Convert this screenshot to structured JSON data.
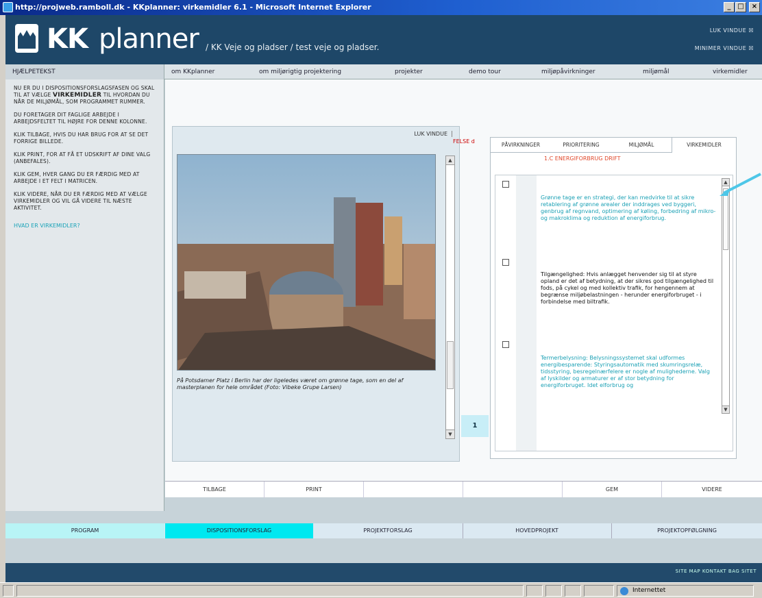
{
  "window": {
    "title": "http://projweb.ramboll.dk - KKplanner: virkemidler 6.1 - Microsoft Internet Explorer",
    "controls": [
      "_",
      "□",
      "×"
    ]
  },
  "header": {
    "brand_kk": "KK",
    "brand_planner": "planner",
    "breadcrumb": "/ KK Veje og pladser / test veje og pladser.",
    "close_window": "LUK VINDUE ☒",
    "minimize_window": "MINIMER VINDUE ☒"
  },
  "nav": {
    "help_heading": "HJÆLPETEKST",
    "items": [
      "om KKplanner",
      "om miljørigtig projektering",
      "projekter",
      "demo tour",
      "miljøpåvirkninger",
      "miljømål",
      "virkemidler"
    ]
  },
  "help": {
    "p1_a": "NU ER DU I DISPOSITIONSFORSLAGSFASEN OG SKAL TIL AT VÆLGE",
    "p1_b": "VIRKEMIDLER",
    "p1_c": "TIL HVORDAN DU NÅR DE MILJØMÅL, SOM PROGRAMMET RUMMER.",
    "p2": "DU FORETAGER DIT FAGLIGE ARBEJDE I ARBEJDSFELTET TIL HØJRE FOR DENNE KOLONNE.",
    "p3": "KLIK TILBAGE, HVIS DU HAR BRUG FOR AT SE DET FORRIGE BILLEDE.",
    "p4": "KLIK PRINT, FOR AT FÅ ET UDSKRIFT AF DINE VALG (ANBEFALES).",
    "p5": "KLIK GEM, HVER GANG DU ER FÆRDIG MED AT ARBEJDE I ET FELT I MATRICEN.",
    "p6": "KLIK VIDERE, NÅR DU ER FÆRDIG MED AT VÆLGE VIRKEMIDLER OG VIL GÅ VIDERE TIL NÆSTE AKTIVITET.",
    "link": "HVAD ER VIRKEMIDLER?"
  },
  "photo_panel": {
    "close_label": "LUK VINDUE",
    "caption": "På Potsdamer Platz i Berlin har der ligeledes været om grønne tage, som en del af masterplanen for hele området (Foto: Vibeke Grupe Larsen)",
    "tab_peek": "FELSE d",
    "row_number": "1"
  },
  "right_panel": {
    "tabs": [
      "PÅVIRKNINGER",
      "PRIORITERING",
      "MILJØMÅL",
      "VIRKEMIDLER"
    ],
    "subheading": "1.C ENERGIFORBRUG DRIFT",
    "items": [
      {
        "text": "Grønne tage er en strategi, der kan medvirke til at sikre retablering af grønne arealer der inddrages ved byggeri, genbrug af regnvand, optimering af køling, forbedring af mikro- og makroklima og reduktion af energiforbrug.",
        "style": "teal"
      },
      {
        "text": "Tilgængelighed: Hvis anlægget henvender sig til at styre opland er det af betydning, at der sikres god tilgængelighed til fods, på cykel og med kollektiv trafik, for hengennem at begrænse miljøbelastningen - herunder energiforbruget - i forbindelse med biltrafik.",
        "style": "dark"
      },
      {
        "text": "Termerbelysning: Belysningssystemet skal udformes energibesparende: Styringsautomatik med skumringsrelæ, tidsstyring, besregelnærfelere er nogle af mulighederne. Valg af lyskilder og armaturer er af stor betydning for energiforbruget. Idet elforbrug og",
        "style": "teal"
      }
    ]
  },
  "buttons": {
    "back": "TILBAGE",
    "print": "PRINT",
    "save": "GEM",
    "next": "VIDERE"
  },
  "steps": [
    "PROGRAM",
    "DISPOSITIONSFORSLAG",
    "PROJEKTFORSLAG",
    "HOVEDPROJEKT",
    "PROJEKTOPFØLGNING"
  ],
  "footer": "SITE MAP   KONTAKT   BAG SITET",
  "status": {
    "zone": "Internettet"
  },
  "colors": {
    "header": "#1e4768",
    "accent_teal": "#1aa0b4",
    "step_program": "#b8f4f6",
    "step_active": "#00e8f0",
    "subheading": "#e0472a"
  }
}
